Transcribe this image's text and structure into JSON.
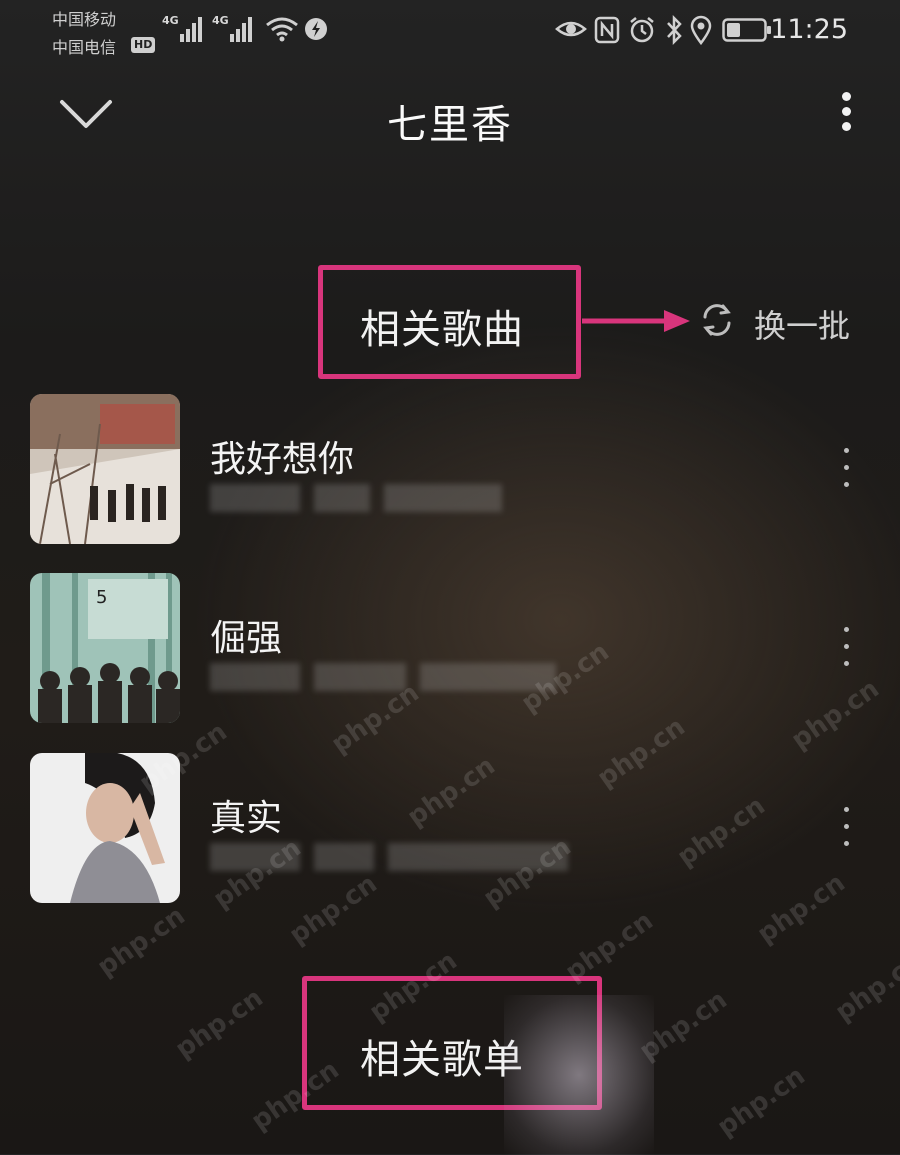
{
  "status_bar": {
    "carrier_1": "中国移动",
    "carrier_2": "中国电信",
    "hd_badge": "HD",
    "net_1": "4G",
    "net_2": "4G",
    "time": "11:25"
  },
  "top_bar": {
    "title": "七里香"
  },
  "related_songs": {
    "header": "相关歌曲",
    "refresh_label": "换一批",
    "songs": [
      {
        "title": "我好想你"
      },
      {
        "title": "倔强"
      },
      {
        "title": "真实"
      }
    ]
  },
  "next_section": {
    "header": "相关歌单"
  },
  "watermark": "php.cn",
  "colors": {
    "highlight": "#d8357c",
    "background": "#1e1c1a"
  }
}
